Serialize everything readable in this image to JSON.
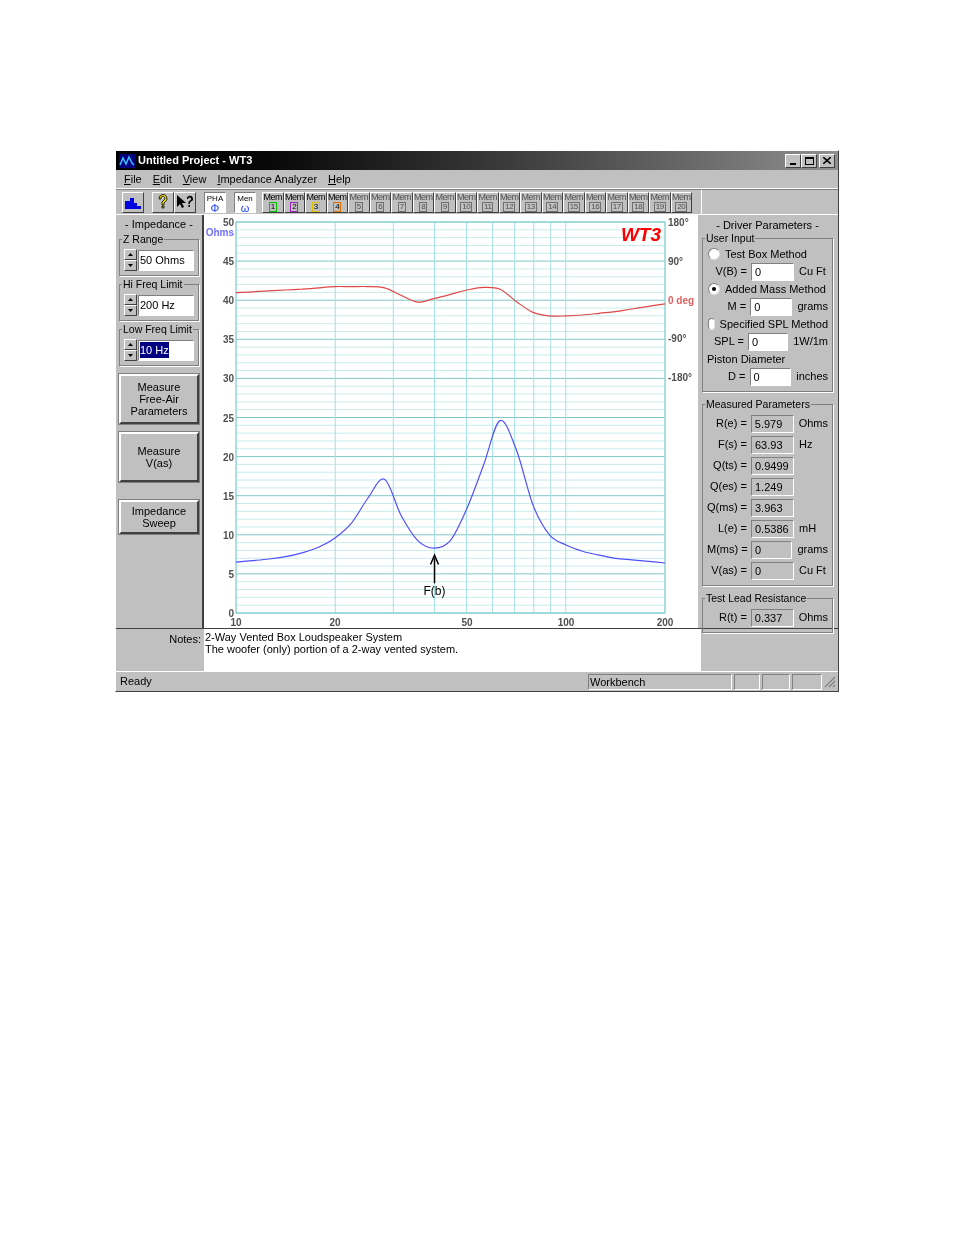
{
  "window": {
    "title": "Untitled Project - WT3"
  },
  "menu": [
    {
      "mnemonic": "F",
      "rest": "ile"
    },
    {
      "mnemonic": "E",
      "rest": "dit"
    },
    {
      "mnemonic": "V",
      "rest": "iew"
    },
    {
      "mnemonic": "I",
      "rest": "mpedance Analyzer"
    },
    {
      "mnemonic": "H",
      "rest": "elp"
    }
  ],
  "toolbar": {
    "tools": [
      {
        "kind": "graph"
      },
      {
        "kind": "help"
      },
      {
        "kind": "context-help"
      }
    ],
    "modes": [
      {
        "label": "PHA",
        "glyph": "Φ",
        "pressed": true
      },
      {
        "label": "Men",
        "glyph": "ω",
        "pressed": true
      }
    ],
    "memories": [
      {
        "label": "Mem",
        "number": "1",
        "disabled": false,
        "color": "#00c000"
      },
      {
        "label": "Mem",
        "number": "2",
        "disabled": false,
        "color": "#a020c0"
      },
      {
        "label": "Mem",
        "number": "3",
        "disabled": false,
        "color": "#e0c000"
      },
      {
        "label": "Mem",
        "number": "4",
        "disabled": false,
        "color": "#e07000"
      },
      {
        "label": "Mem",
        "number": "5",
        "disabled": true
      },
      {
        "label": "Mem",
        "number": "6",
        "disabled": true
      },
      {
        "label": "Mem",
        "number": "7",
        "disabled": true
      },
      {
        "label": "Mem",
        "number": "8",
        "disabled": true
      },
      {
        "label": "Mem",
        "number": "9",
        "disabled": true
      },
      {
        "label": "Mem",
        "number": "10",
        "disabled": true
      },
      {
        "label": "Mem",
        "number": "11",
        "disabled": true
      },
      {
        "label": "Mem",
        "number": "12",
        "disabled": true
      },
      {
        "label": "Mem",
        "number": "13",
        "disabled": true
      },
      {
        "label": "Mem",
        "number": "14",
        "disabled": true
      },
      {
        "label": "Mem",
        "number": "15",
        "disabled": true
      },
      {
        "label": "Mem",
        "number": "16",
        "disabled": true
      },
      {
        "label": "Mem",
        "number": "17",
        "disabled": true
      },
      {
        "label": "Mem",
        "number": "18",
        "disabled": true
      },
      {
        "label": "Mem",
        "number": "19",
        "disabled": true
      },
      {
        "label": "Mem",
        "number": "20",
        "disabled": true
      }
    ]
  },
  "impedance_panel": {
    "heading": "- Impedance -",
    "spinners": [
      {
        "label": "Z Range",
        "value": "50 Ohms",
        "selected": false
      },
      {
        "label": "Hi Freq Limit",
        "value": "200 Hz",
        "selected": false
      },
      {
        "label": "Low Freq Limit",
        "value": "10 Hz",
        "selected": true
      }
    ],
    "buttons": [
      "Measure Free-Air Parameters",
      "Measure V(as)",
      "Impedance Sweep"
    ]
  },
  "chart": {
    "logo": "WT3",
    "y_unit": "Ohms",
    "chart_data": {
      "type": "line",
      "categories": [
        "10",
        null,
        null,
        null,
        null,
        null,
        "20",
        null,
        null,
        null,
        null,
        null,
        null,
        null,
        "50",
        null,
        null,
        null,
        null,
        null,
        "100",
        null,
        null,
        null,
        null,
        null,
        "200"
      ],
      "series": [
        {
          "color": "#5050ff",
          "values": [
            6.5,
            6.7,
            6.9,
            7.2,
            7.7,
            8.4,
            9.6,
            11.5,
            14.7,
            17.1,
            12.5,
            9.3,
            8.3,
            9.3,
            13.4,
            18.9,
            24.6,
            20.8,
            13.8,
            10,
            8.7,
            7.9,
            7.4,
            7,
            6.8,
            6.6,
            6.4
          ]
        }
      ],
      "ylim": [
        0,
        50
      ],
      "yticks": [
        0,
        5,
        10,
        15,
        20,
        25,
        30,
        35,
        40,
        45,
        50
      ],
      "grid": true,
      "annotations": [
        "F(b)"
      ]
    },
    "phase": {
      "chart_data": {
        "type": "line",
        "categories": [
          null,
          null,
          null,
          null,
          null,
          null,
          null,
          null,
          null,
          null,
          null,
          null,
          null,
          null,
          null,
          null,
          null,
          null,
          null,
          null,
          null,
          null,
          null,
          null,
          null,
          null,
          null
        ],
        "series": [
          {
            "color": "#e04848",
            "values": [
              16,
              18,
              20,
              22,
              24,
              27,
              30,
              30,
              30,
              27,
              10,
              -6,
              2,
              12,
              22,
              28,
              24,
              -5,
              -30,
              -38,
              -38,
              -36,
              -32,
              -28,
              -22,
              -16,
              -10
            ]
          }
        ],
        "ylim": [
          -180,
          180
        ],
        "yticks": [
          {
            "value": 180,
            "label": "180°"
          },
          {
            "value": 90,
            "label": "90°"
          },
          {
            "value": 0,
            "label": "0 deg"
          },
          {
            "value": -90,
            "label": "-90°"
          },
          {
            "value": -180,
            "label": "-180°"
          }
        ]
      }
    }
  },
  "driver_parameters": {
    "heading": "- Driver Parameters -",
    "user_input": {
      "legend": "User Input",
      "methods": [
        {
          "label": "Test Box Method",
          "selected": false,
          "field": {
            "label": "V(B) =",
            "value": "0",
            "unit": "Cu Ft"
          }
        },
        {
          "label": "Added Mass Method",
          "selected": true,
          "field": {
            "label": "M =",
            "value": "0",
            "unit": "grams"
          }
        },
        {
          "label": "Specified SPL Method",
          "selected": false,
          "field": {
            "label": "SPL =",
            "value": "0",
            "unit": "1W/1m"
          }
        }
      ],
      "piston": {
        "label": "Piston Diameter",
        "field": {
          "label": "D =",
          "value": "0",
          "unit": "inches"
        }
      }
    },
    "measured": {
      "legend": "Measured Parameters",
      "rows": [
        {
          "label": "R(e) =",
          "value": "5.979",
          "unit": "Ohms"
        },
        {
          "label": "F(s) =",
          "value": "63.93",
          "unit": "Hz"
        },
        {
          "label": "Q(ts) =",
          "value": "0.9499"
        },
        {
          "label": "Q(es) =",
          "value": "1.249"
        },
        {
          "label": "Q(ms) =",
          "value": "3.963"
        },
        {
          "label": "L(e) =",
          "value": "0.5386",
          "unit": "mH"
        },
        {
          "label": "M(ms) =",
          "value": "0",
          "unit": "grams"
        },
        {
          "label": "V(as) =",
          "value": "0",
          "unit": "Cu Ft"
        }
      ]
    },
    "test_lead": {
      "legend": "Test Lead Resistance",
      "rows": [
        {
          "label": "R(t) =",
          "value": "0.337",
          "unit": "Ohms"
        }
      ]
    }
  },
  "notes": {
    "label": "Notes:",
    "lines": [
      "2-Way Vented Box Loudspeaker System",
      "The woofer (only) portion of a 2-way vented system."
    ]
  },
  "status_bar": {
    "message": "Ready",
    "panes": [
      "Workbench"
    ]
  }
}
